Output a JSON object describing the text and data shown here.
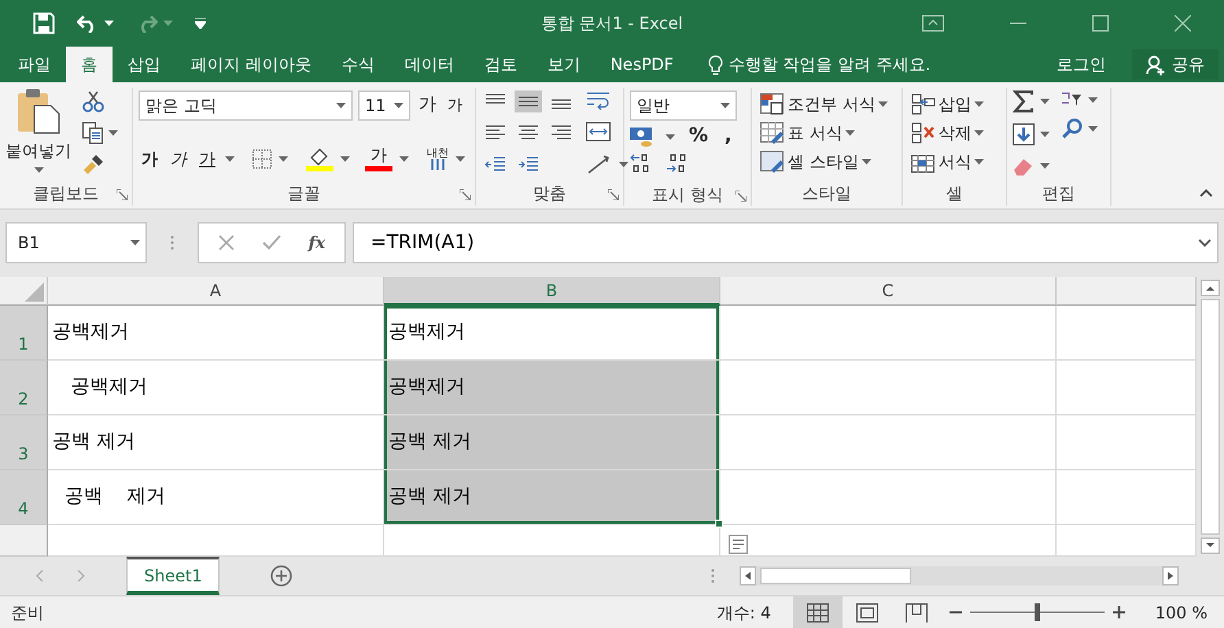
{
  "title_bar": {
    "title": "통합 문서1 - Excel"
  },
  "ribbon_tabs": [
    {
      "label": "파일",
      "selected": false
    },
    {
      "label": "홈",
      "selected": true
    },
    {
      "label": "삽입",
      "selected": false
    },
    {
      "label": "페이지 레이아웃",
      "selected": false
    },
    {
      "label": "수식",
      "selected": false
    },
    {
      "label": "데이터",
      "selected": false
    },
    {
      "label": "검토",
      "selected": false
    },
    {
      "label": "보기",
      "selected": false
    },
    {
      "label": "NesPDF",
      "selected": false
    }
  ],
  "tell_me": "수행할 작업을 알려 주세요.",
  "sign_in": "로그인",
  "share": "공유",
  "ribbon": {
    "clipboard": {
      "paste": "붙여넣기",
      "label": "클립보드"
    },
    "font": {
      "name": "맑은 고딕",
      "size": "11",
      "grow": "가",
      "shrink": "가",
      "bold": "가",
      "italic": "가",
      "underline": "가",
      "font_color": "가",
      "phonetic": "내천",
      "label": "글꼴"
    },
    "alignment": {
      "vertical": [
        {
          "kind": "top",
          "selected": false
        },
        {
          "kind": "middle",
          "selected": true
        },
        {
          "kind": "bottom",
          "selected": false
        }
      ],
      "label": "맞춤"
    },
    "number": {
      "format": "일반",
      "percent": "%",
      "comma": ",",
      "label": "표시 형식"
    },
    "styles": {
      "items": [
        "조건부 서식",
        "표 서식",
        "셀 스타일"
      ],
      "label": "스타일"
    },
    "cells": {
      "items": [
        "삽입",
        "삭제",
        "서식"
      ],
      "label": "셀"
    },
    "editing": {
      "label": "편집"
    }
  },
  "formula_bar": {
    "name_box": "B1",
    "function_label": "fx",
    "formula": "=TRIM(A1)"
  },
  "sheet": {
    "columns": [
      {
        "label": "A",
        "selected": false
      },
      {
        "label": "B",
        "selected": true
      },
      {
        "label": "C",
        "selected": false
      }
    ],
    "rows": [
      {
        "header": "1",
        "selected": true,
        "cells": [
          {
            "text": "공백제거",
            "selected": false
          },
          {
            "text": "공백제거",
            "selected": true,
            "active": true
          },
          {
            "selected": false
          }
        ]
      },
      {
        "header": "2",
        "selected": true,
        "cells": [
          {
            "text": "   공백제거",
            "selected": false
          },
          {
            "text": "공백제거",
            "selected": true,
            "active": false
          },
          {
            "selected": false
          }
        ]
      },
      {
        "header": "3",
        "selected": true,
        "cells": [
          {
            "text": "공백 제거",
            "selected": false
          },
          {
            "text": "공백 제거",
            "selected": true,
            "active": false
          },
          {
            "selected": false
          }
        ]
      },
      {
        "header": "4",
        "selected": true,
        "cells": [
          {
            "text": "  공백    제거",
            "selected": false
          },
          {
            "text": "공백 제거",
            "selected": true,
            "active": false
          },
          {
            "selected": false
          }
        ]
      }
    ]
  },
  "sheet_tabs": [
    {
      "label": "Sheet1",
      "selected": true
    }
  ],
  "status_bar": {
    "mode": "준비",
    "count": "개수: 4",
    "views": [
      {
        "kind": "normal",
        "selected": true
      },
      {
        "kind": "page_layout",
        "selected": false
      },
      {
        "kind": "page_break",
        "selected": false
      }
    ],
    "zoom": {
      "level": 0.5
    },
    "zoom_label": "100 %"
  }
}
